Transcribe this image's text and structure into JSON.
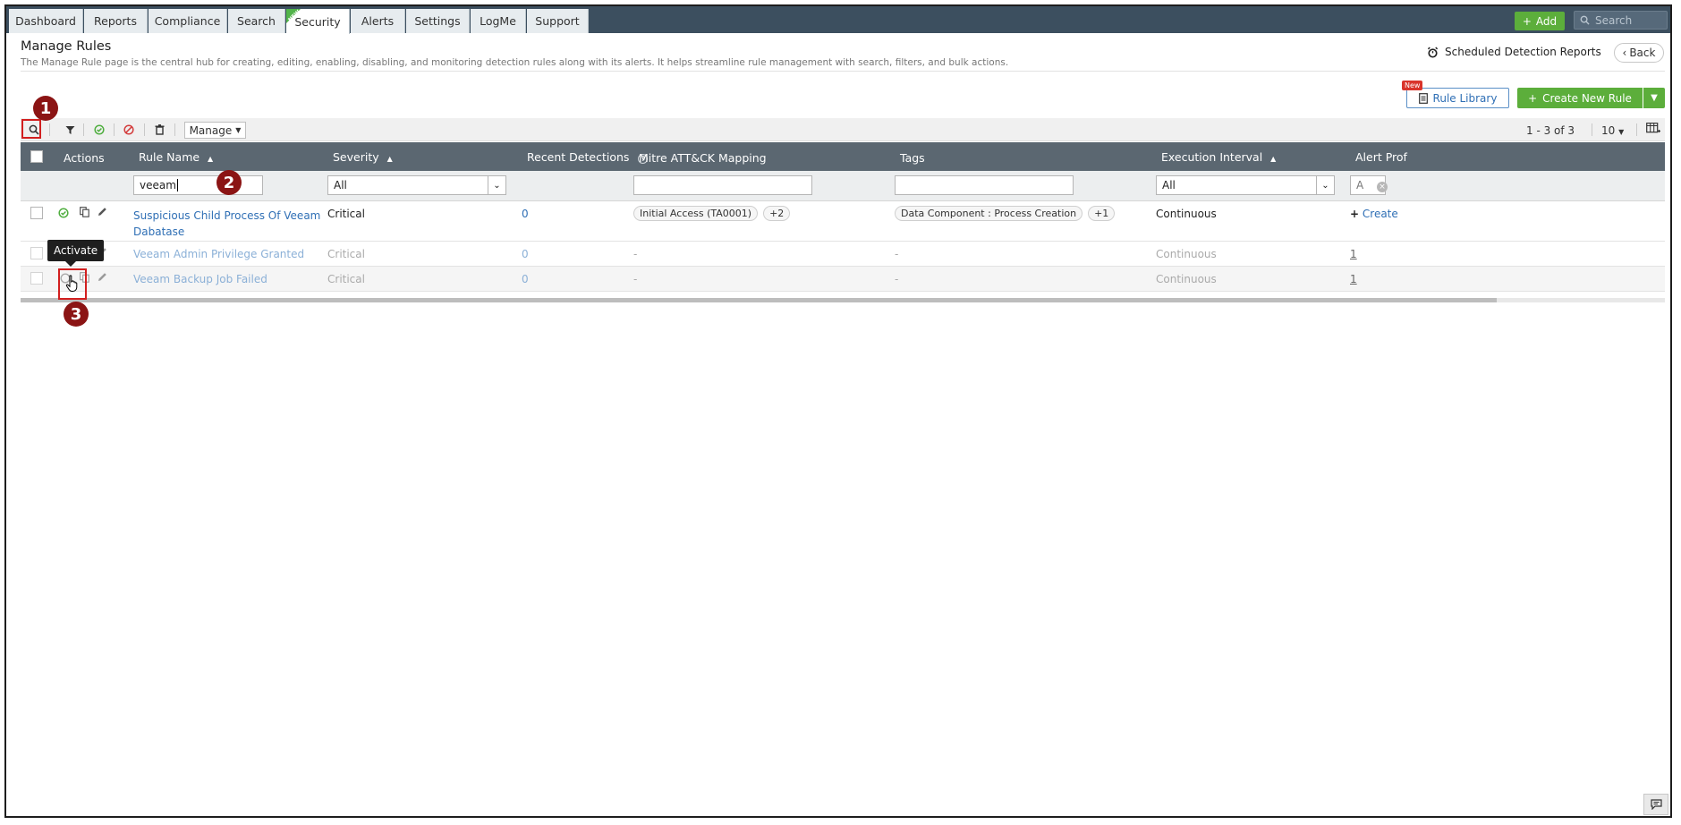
{
  "nav": {
    "tabs": [
      "Dashboard",
      "Reports",
      "Compliance",
      "Search",
      "Security",
      "Alerts",
      "Settings",
      "LogMe",
      "Support"
    ],
    "active_tab": "Security",
    "new_ribbon": "NEW",
    "add_label": "Add",
    "search_placeholder": "Search"
  },
  "header": {
    "title": "Manage Rules",
    "description": "The Manage Rule page is the central hub for creating, editing, enabling, disabling, and monitoring detection rules along with its alerts. It helps streamline rule management with search, filters, and bulk actions.",
    "scheduled_reports": "Scheduled Detection Reports",
    "back": "Back"
  },
  "actions": {
    "rule_library": "Rule Library",
    "new_badge": "New",
    "create_rule": "Create New Rule"
  },
  "toolbar": {
    "manage": "Manage",
    "pager": "1 - 3 of 3",
    "per_page": "10"
  },
  "table": {
    "columns": {
      "actions": "Actions",
      "rule_name": "Rule Name",
      "severity": "Severity",
      "recent_detections": "Recent Detections",
      "mitre": "Mitre ATT&CK Mapping",
      "tags": "Tags",
      "execution_interval": "Execution Interval",
      "alert_profile": "Alert Prof"
    },
    "filters": {
      "rule_name": "veeam",
      "severity": "All",
      "execution_interval": "All",
      "alert_profile": "A"
    },
    "rows": [
      {
        "rule_name_line1": "Suspicious Child Process Of Veeam",
        "rule_name_line2": "Dabatase",
        "severity": "Critical",
        "detections": "0",
        "mitre": "Initial Access (TA0001)",
        "mitre_more": "+2",
        "tags": "Data Component : Process Creation",
        "tags_more": "+1",
        "interval": "Continuous",
        "alert": "Create"
      },
      {
        "rule_name_line1": "Veeam Admin Privilege Granted",
        "severity": "Critical",
        "detections": "0",
        "mitre": "-",
        "tags": "-",
        "interval": "Continuous",
        "alert": "1"
      },
      {
        "rule_name_line1": "Veeam Backup Job Failed",
        "severity": "Critical",
        "detections": "0",
        "mitre": "-",
        "tags": "-",
        "interval": "Continuous",
        "alert": "1"
      }
    ]
  },
  "tooltip": "Activate",
  "annotations": [
    "1",
    "2",
    "3"
  ],
  "colors": {
    "nav_bg": "#3c4f5f",
    "primary_green": "#5cae3b",
    "link_blue": "#2f6fb5",
    "table_header": "#5b6771",
    "annotation_red": "#d21f1f",
    "annotation_badge": "#8b1414"
  }
}
